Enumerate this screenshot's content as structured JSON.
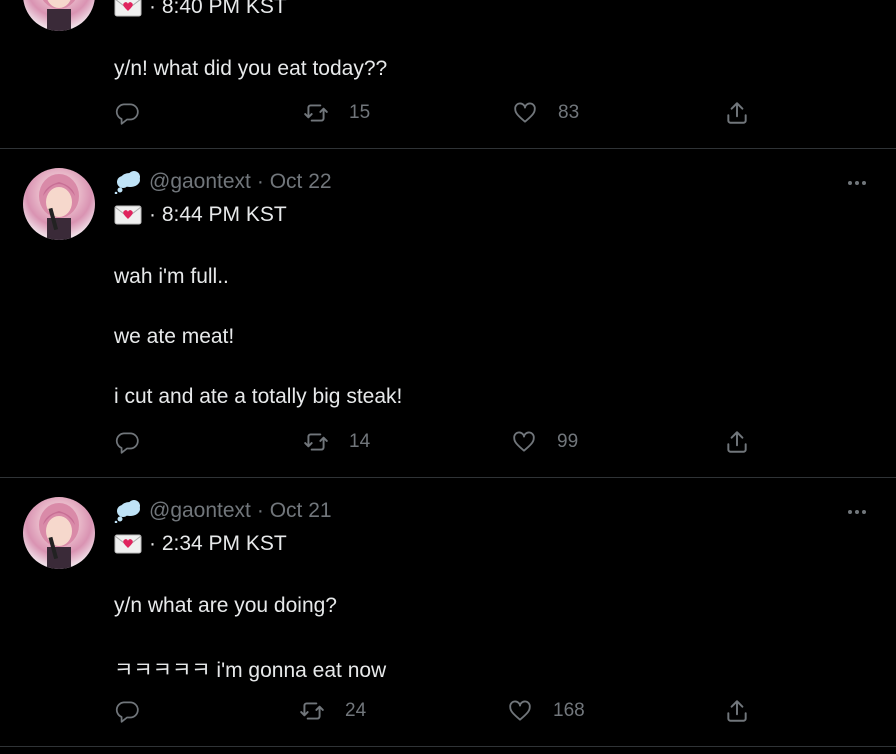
{
  "theme": {
    "background": "#000000",
    "text": "#e7e9ea",
    "muted": "#71767b",
    "divider": "#2f3336"
  },
  "tweets": [
    {
      "handle": "",
      "date": "",
      "time_line": "· 8:40 PM KST",
      "lines": [
        "y/n! what did you eat today??"
      ],
      "retweets": "15",
      "likes": "83",
      "icons": {
        "reply": "reply-icon",
        "retweet": "retweet-icon",
        "like": "heart-icon",
        "share": "share-icon",
        "emoji_top": "thought-balloon-icon",
        "emoji_mail": "love-letter-icon"
      }
    },
    {
      "handle": "@gaontext",
      "date": "· Oct 22",
      "time_line": "· 8:44 PM KST",
      "lines": [
        "wah i'm full..",
        "we ate meat!",
        "i cut and ate a totally big steak!"
      ],
      "retweets": "14",
      "likes": "99",
      "icons": {
        "reply": "reply-icon",
        "retweet": "retweet-icon",
        "like": "heart-icon",
        "share": "share-icon",
        "emoji_top": "thought-balloon-icon",
        "emoji_mail": "love-letter-icon"
      }
    },
    {
      "handle": "@gaontext",
      "date": "· Oct 21",
      "time_line": "· 2:34 PM KST",
      "lines": [
        "y/n what are you doing?",
        "ㅋㅋㅋㅋㅋ i'm gonna eat now"
      ],
      "retweets": "24",
      "likes": "168",
      "icons": {
        "reply": "reply-icon",
        "retweet": "retweet-icon",
        "like": "heart-icon",
        "share": "share-icon",
        "emoji_top": "thought-balloon-icon",
        "emoji_mail": "love-letter-icon"
      }
    }
  ]
}
